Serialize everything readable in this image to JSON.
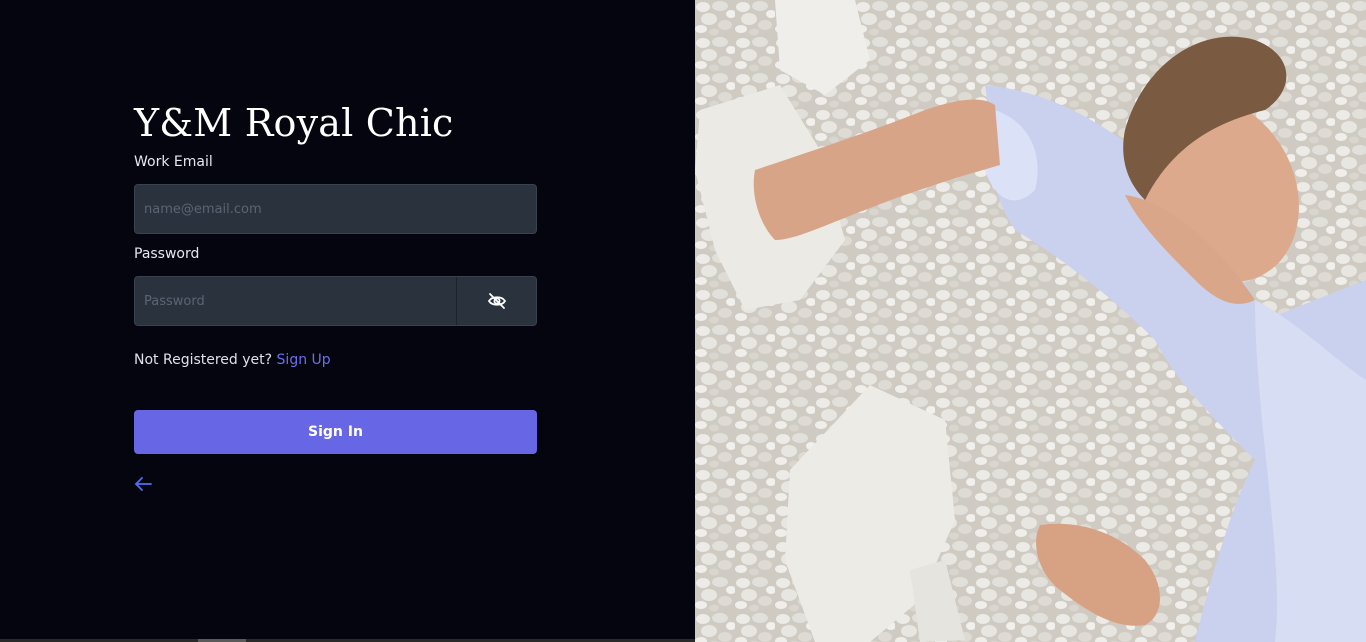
{
  "brand": {
    "title": "Y&M Royal Chic"
  },
  "form": {
    "email_label": "Work Email",
    "email_placeholder": "name@email.com",
    "email_value": "",
    "password_label": "Password",
    "password_placeholder": "Password",
    "password_value": "",
    "toggle_icon": "eye-off-icon",
    "signup_prompt": "Not Registered yet?",
    "signup_link": "Sign Up",
    "signin_label": "Sign In",
    "back_icon": "arrow-left-icon"
  },
  "colors": {
    "background": "#05050f",
    "input_bg": "#2a323e",
    "accent": "#6767e6",
    "link": "#6d6df0"
  },
  "hero_image": {
    "description_icon": "fashion-photo"
  }
}
